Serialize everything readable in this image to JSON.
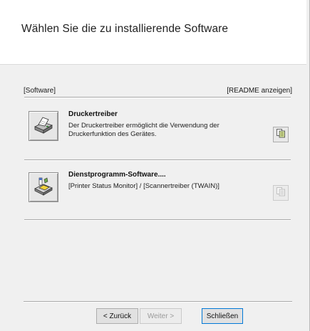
{
  "header": {
    "title": "Wählen Sie die zu installierende Software"
  },
  "section": {
    "left_label": "[Software]",
    "right_label": "[README anzeigen]"
  },
  "items": [
    {
      "title": "Druckertreiber",
      "description": "Der Druckertreiber ermöglicht die Verwendung der Druckerfunktion des Gerätes.",
      "icon": "printer-icon",
      "readme_icon": "document-copy-icon"
    },
    {
      "title": "Dienstprogramm-Software....",
      "description": "[Printer Status Monitor] / [Scannertreiber (TWAIN)]",
      "icon": "utility-disk-icon",
      "readme_icon": "document-copy-icon"
    }
  ],
  "footer": {
    "back_label": "< Zurück",
    "next_label": "Weiter >",
    "close_label": "Schließen"
  }
}
